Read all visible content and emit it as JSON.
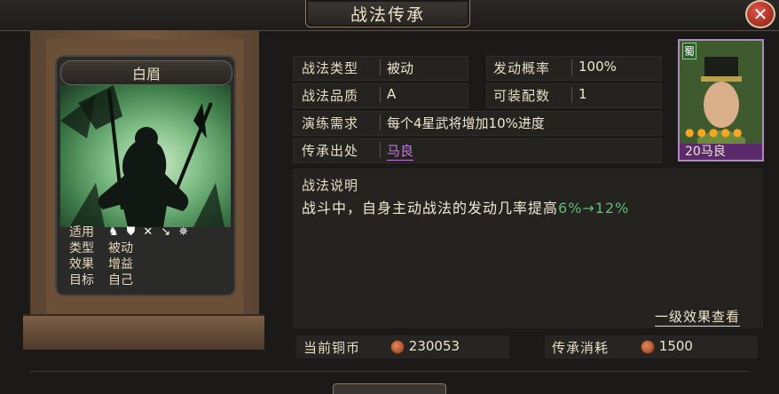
{
  "window": {
    "title": "战法传承",
    "close": "✕"
  },
  "skill_card": {
    "name": "白眉",
    "info": [
      {
        "key": "适用",
        "value": ""
      },
      {
        "key": "类型",
        "value": "被动"
      },
      {
        "key": "效果",
        "value": "增益"
      },
      {
        "key": "目标",
        "value": "自己"
      }
    ],
    "troop_icons": [
      "cavalry-icon",
      "shield-icon",
      "bow-icon",
      "spear-icon",
      "wheel-icon"
    ]
  },
  "details": {
    "type_label": "战法类型",
    "type_value": "被动",
    "rate_label": "发动概率",
    "rate_value": "100%",
    "quality_label": "战法品质",
    "quality_value": "A",
    "equip_label": "可装配数",
    "equip_value": "1",
    "training_label": "演练需求",
    "training_value": "每个4星武将增加10%进度",
    "source_label": "传承出处",
    "source_value": "马良"
  },
  "hero": {
    "faction": "蜀",
    "level": "20",
    "name": "马良",
    "stars": 5,
    "accent": "#b089c0"
  },
  "description": {
    "label": "战法说明",
    "text": "战斗中，自身主动战法的发动几率提高",
    "highlight": "6%→12%",
    "highlight_color": "#5bbf74"
  },
  "effects_link": "一级效果查看",
  "footer": {
    "copper_label": "当前铜币",
    "copper_value": "230053",
    "cost_label": "传承消耗",
    "cost_value": "1500"
  }
}
